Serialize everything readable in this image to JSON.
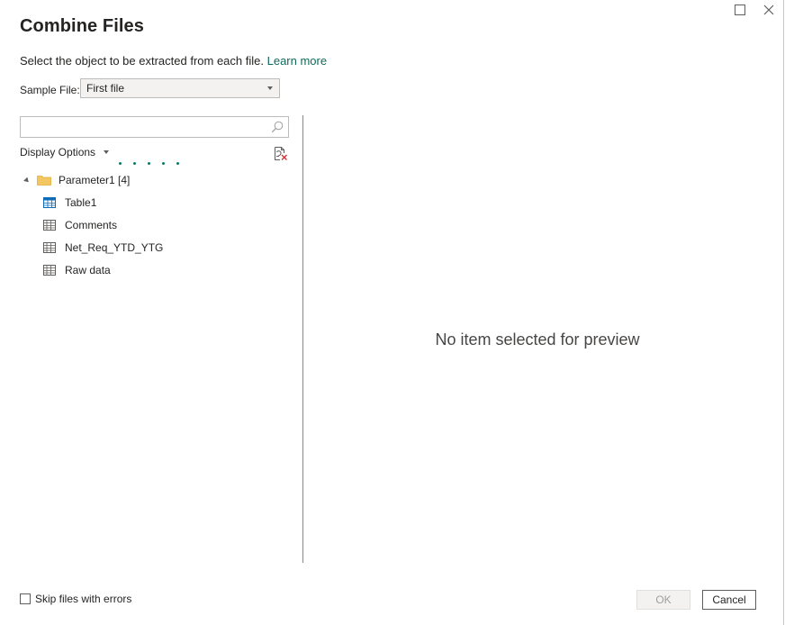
{
  "dialog": {
    "title": "Combine Files",
    "subtitle": "Select the object to be extracted from each file.",
    "learn_more": "Learn more"
  },
  "window_controls": {
    "maximize_icon": "maximize-icon",
    "close_icon": "close-icon"
  },
  "sample_file": {
    "label": "Sample File:",
    "value": "First file"
  },
  "search": {
    "value": "",
    "placeholder": "",
    "icon": "search-icon"
  },
  "display_options": {
    "label": "Display Options",
    "refresh_icon": "refresh-preview-icon"
  },
  "tree": {
    "root": {
      "label": "Parameter1 [4]",
      "icon": "folder-icon",
      "expanded": true
    },
    "items": [
      {
        "label": "Table1",
        "icon": "table-icon"
      },
      {
        "label": "Comments",
        "icon": "sheet-icon"
      },
      {
        "label": "Net_Req_YTD_YTG",
        "icon": "sheet-icon"
      },
      {
        "label": "Raw data",
        "icon": "sheet-icon"
      }
    ]
  },
  "preview": {
    "message": "No item selected for preview"
  },
  "footer": {
    "skip_label": "Skip files with errors",
    "skip_checked": false,
    "ok_label": "OK",
    "cancel_label": "Cancel"
  },
  "colors": {
    "link": "#0f6a5c",
    "loading_dots": "#117865",
    "folder": "#f2c661",
    "table_icon": "#0e6bb8"
  }
}
